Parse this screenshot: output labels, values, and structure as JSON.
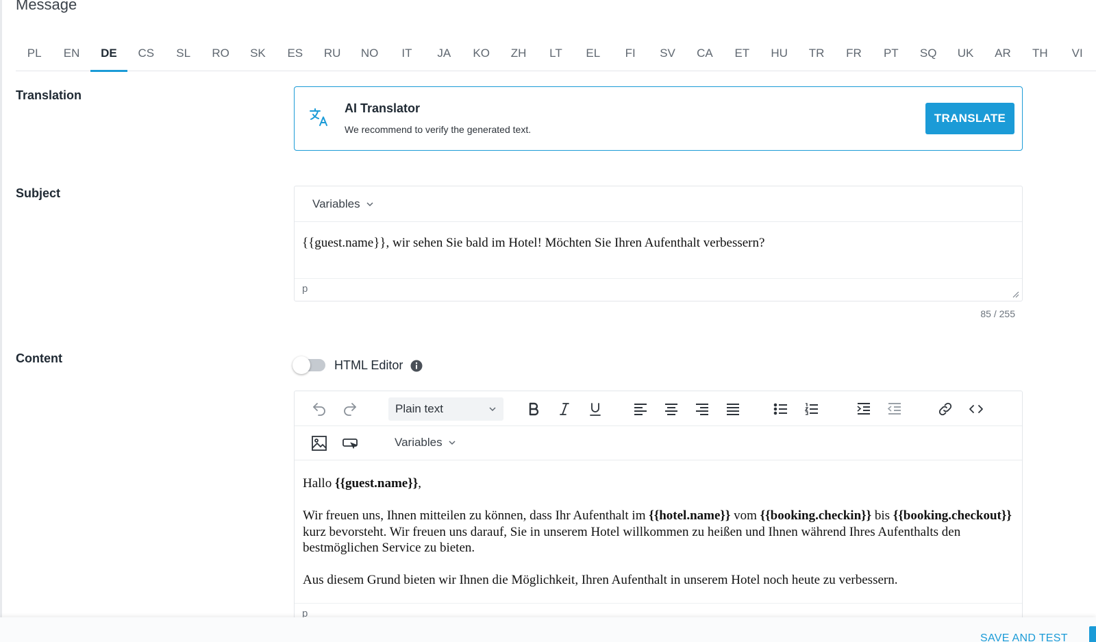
{
  "page": {
    "title": "Message"
  },
  "languages": {
    "items": [
      "PL",
      "EN",
      "DE",
      "CS",
      "SL",
      "RO",
      "SK",
      "ES",
      "RU",
      "NO",
      "IT",
      "JA",
      "KO",
      "ZH",
      "LT",
      "EL",
      "FI",
      "SV",
      "CA",
      "ET",
      "HU",
      "TR",
      "FR",
      "PT",
      "SQ",
      "UK",
      "AR",
      "TH",
      "VI"
    ],
    "active": "DE"
  },
  "translation": {
    "label": "Translation",
    "title": "AI Translator",
    "subtitle": "We recommend to verify the generated text.",
    "button": "TRANSLATE",
    "icon": "translate-icon"
  },
  "subject": {
    "label": "Subject",
    "variables": "Variables",
    "value": "{{guest.name}}, wir sehen Sie bald im Hotel! Möchten Sie Ihren Aufenthalt verbessern?",
    "status": "p",
    "counter": "85 / 255"
  },
  "content": {
    "label": "Content",
    "html_editor_label": "HTML Editor",
    "html_editor_enabled": false,
    "block_format": "Plain text",
    "variables": "Variables",
    "status": "p",
    "body": {
      "p1_pre": "Hallo ",
      "p1_var": "{{guest.name}}",
      "p1_post": ",",
      "p2_a": "Wir freuen uns, Ihnen mitteilen zu können, dass Ihr Aufenthalt im ",
      "p2_var1": "{{hotel.name}}",
      "p2_b": " vom ",
      "p2_var2": "{{booking.checkin}}",
      "p2_c": " bis ",
      "p2_var3": "{{booking.checkout}}",
      "p2_d": " kurz bevorsteht. Wir freuen uns darauf, Sie in unserem Hotel willkommen zu heißen und Ihnen während Ihres Aufenthalts den bestmöglichen Service zu bieten.",
      "p3": "Aus diesem Grund bieten wir Ihnen die Möglichkeit, Ihren Aufenthalt in unserem Hotel noch heute zu verbessern."
    },
    "toolbar_icons": [
      "undo-icon",
      "redo-icon",
      "bold-icon",
      "italic-icon",
      "underline-icon",
      "align-left-icon",
      "align-center-icon",
      "align-right-icon",
      "align-justify-icon",
      "bullet-list-icon",
      "numbered-list-icon",
      "indent-icon",
      "outdent-icon",
      "link-icon",
      "code-icon",
      "image-icon",
      "button-insert-icon"
    ]
  },
  "footer": {
    "save_and_test": "SAVE AND TEST"
  },
  "colors": {
    "accent": "#1b9bd7",
    "text": "#1f2933",
    "border": "#e3e6ea"
  }
}
